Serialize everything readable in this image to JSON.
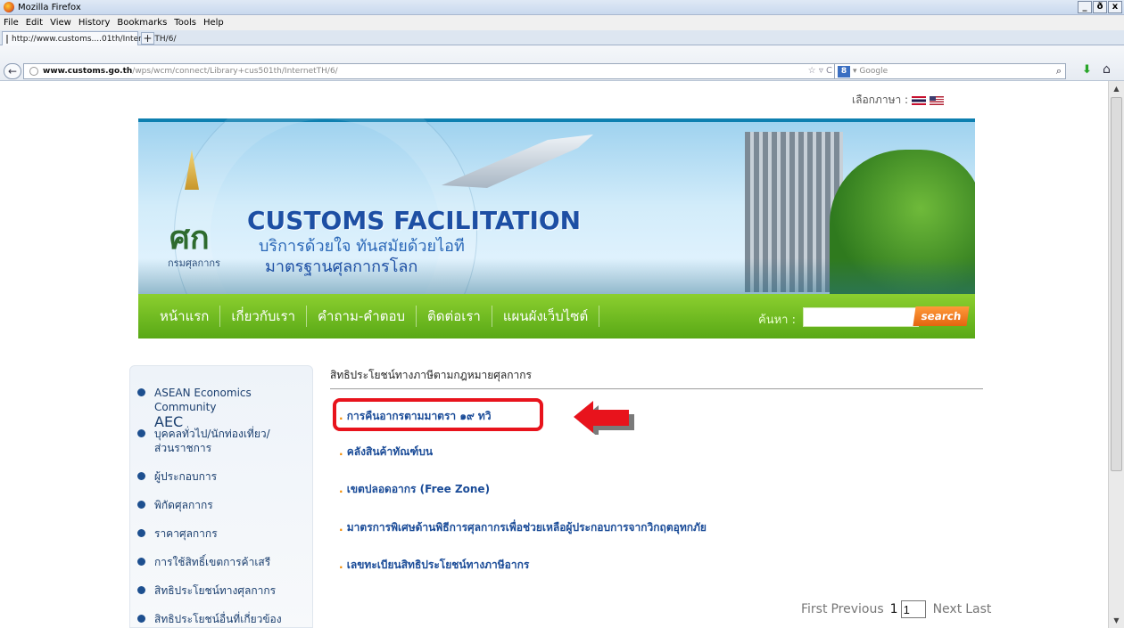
{
  "browser": {
    "window_title": "Mozilla Firefox",
    "window_buttons": [
      "_",
      "ð",
      "x"
    ],
    "menu": [
      "File",
      "Edit",
      "View",
      "History",
      "Bookmarks",
      "Tools",
      "Help"
    ],
    "tab_title": "http://www.customs....01th/InternetTH/6/",
    "new_tab": "+",
    "url_domain": "www.customs.go.th",
    "url_path": "/wps/wcm/connect/Library+cus501th/InternetTH/6/",
    "url_controls": "☆ ▿ C",
    "search_engine_badge": "8",
    "search_placeholder": "▾ Google",
    "icons": {
      "back": "back-arrow-icon",
      "search": "magnifier-icon",
      "download": "download-arrow-icon",
      "home": "home-icon"
    }
  },
  "page": {
    "language_label": "เลือกภาษา :",
    "banner": {
      "emblem_caption": "กรมศุลกากร",
      "emblem_mark": "ศก",
      "title": "CUSTOMS FACILITATION",
      "subtitle_1": "บริการด้วยใจ ทันสมัยด้วยไอที",
      "subtitle_2": "มาตรฐานศุลกากรโลก"
    },
    "nav": [
      "หน้าแรก",
      "เกี่ยวกับเรา",
      "คำถาม-คำตอบ",
      "ติดต่อเรา",
      "แผนผังเว็บไซต์"
    ],
    "search_label": "ค้นหา :",
    "search_value": "",
    "search_button": "search",
    "sidebar": [
      {
        "line1": "ASEAN Economics Community",
        "line2": "AEC"
      },
      {
        "line1": "บุคคลทั่วไป/นักท่องเที่ยว/",
        "line2": "ส่วนราชการ"
      },
      {
        "line1": "ผู้ประกอบการ"
      },
      {
        "line1": "พิกัดศุลกากร"
      },
      {
        "line1": "ราคาศุลกากร"
      },
      {
        "line1": "การใช้สิทธิ์เขตการค้าเสรี"
      },
      {
        "line1": "สิทธิประโยชน์ทางศุลกากร"
      },
      {
        "line1": "สิทธิประโยชน์อื่นที่เกี่ยวข้อง"
      }
    ],
    "section_title": "สิทธิประโยชน์ทางภาษีตามกฎหมายศุลกากร",
    "links": [
      "การคืนอากรตามมาตรา ๑๙ ทวิ",
      "คลังสินค้าทัณฑ์บน",
      "เขตปลอดอากร (Free Zone)",
      "มาตรการพิเศษด้านพิธีการศุลกากรเพื่อช่วยเหลือผู้ประกอบการจากวิกฤตอุทกภัย",
      "เลขทะเบียนสิทธิประโยชน์ทางภาษีอากร"
    ],
    "link_bullet": ".",
    "pager": {
      "first": "First",
      "previous": "Previous",
      "current": "1",
      "input_value": "1",
      "next": "Next",
      "last": "Last"
    }
  },
  "colors": {
    "accent_green": "#58a816",
    "link_blue": "#1b4c98",
    "highlight_red": "#e8131c",
    "search_orange": "#e4650f"
  }
}
